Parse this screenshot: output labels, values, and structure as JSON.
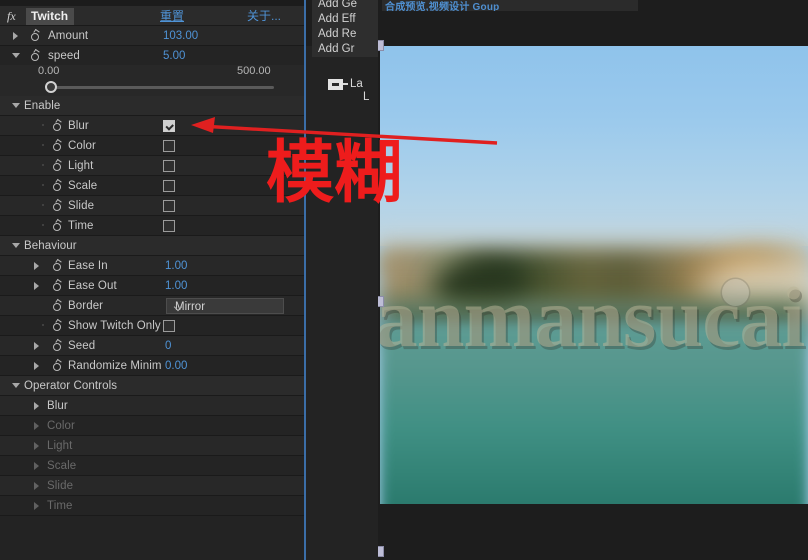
{
  "effect_panel": {
    "fx_badge": "fx",
    "effect_name": "Twitch",
    "reset_label": "重置",
    "about_label": "关于...",
    "rows": [
      {
        "label": "Amount",
        "value": "103.00",
        "type": "value",
        "indent": 0,
        "arrow": "right"
      },
      {
        "label": "speed",
        "value": "5.00",
        "type": "value",
        "indent": 0,
        "arrow": "down"
      }
    ],
    "slider": {
      "min": "0.00",
      "max": "500.00"
    },
    "groups": [
      {
        "title": "Enable",
        "items": [
          {
            "label": "Blur",
            "checked": true
          },
          {
            "label": "Color",
            "checked": false
          },
          {
            "label": "Light",
            "checked": false
          },
          {
            "label": "Scale",
            "checked": false
          },
          {
            "label": "Slide",
            "checked": false
          },
          {
            "label": "Time",
            "checked": false
          }
        ]
      },
      {
        "title": "Behaviour",
        "items": [
          {
            "label": "Ease In",
            "value": "1.00"
          },
          {
            "label": "Ease Out",
            "value": "1.00"
          },
          {
            "label": "Border",
            "value": "Mirror"
          },
          {
            "label": "Show Twitch Only",
            "checked": false
          },
          {
            "label": "Seed",
            "value": "0"
          },
          {
            "label": "Randomize Minim",
            "value": "0.00"
          }
        ]
      },
      {
        "title": "Operator Controls",
        "items": [
          {
            "label": "Blur",
            "enabled": true
          },
          {
            "label": "Color",
            "enabled": false
          },
          {
            "label": "Light",
            "enabled": false
          },
          {
            "label": "Scale",
            "enabled": false
          },
          {
            "label": "Slide",
            "enabled": false
          },
          {
            "label": "Time",
            "enabled": false
          }
        ]
      }
    ]
  },
  "timeline_panel": {
    "menu_items": [
      "Add Ge",
      "Add Eff",
      "Add Re",
      "Add Gr"
    ],
    "layer_label": "La",
    "layer_label2": "L"
  },
  "preview": {
    "title_bar": "合成预览,视频设计  Goup",
    "watermark": "manmansucai"
  },
  "annotation": {
    "text": "模糊",
    "color": "#ee1c1c"
  },
  "colors": {
    "panel_bg": "#232323",
    "row_bg": "#282828",
    "accent_blue": "#4f93d6",
    "divider_blue": "#3b6ea8",
    "annotation_red": "#ee1c1c"
  }
}
